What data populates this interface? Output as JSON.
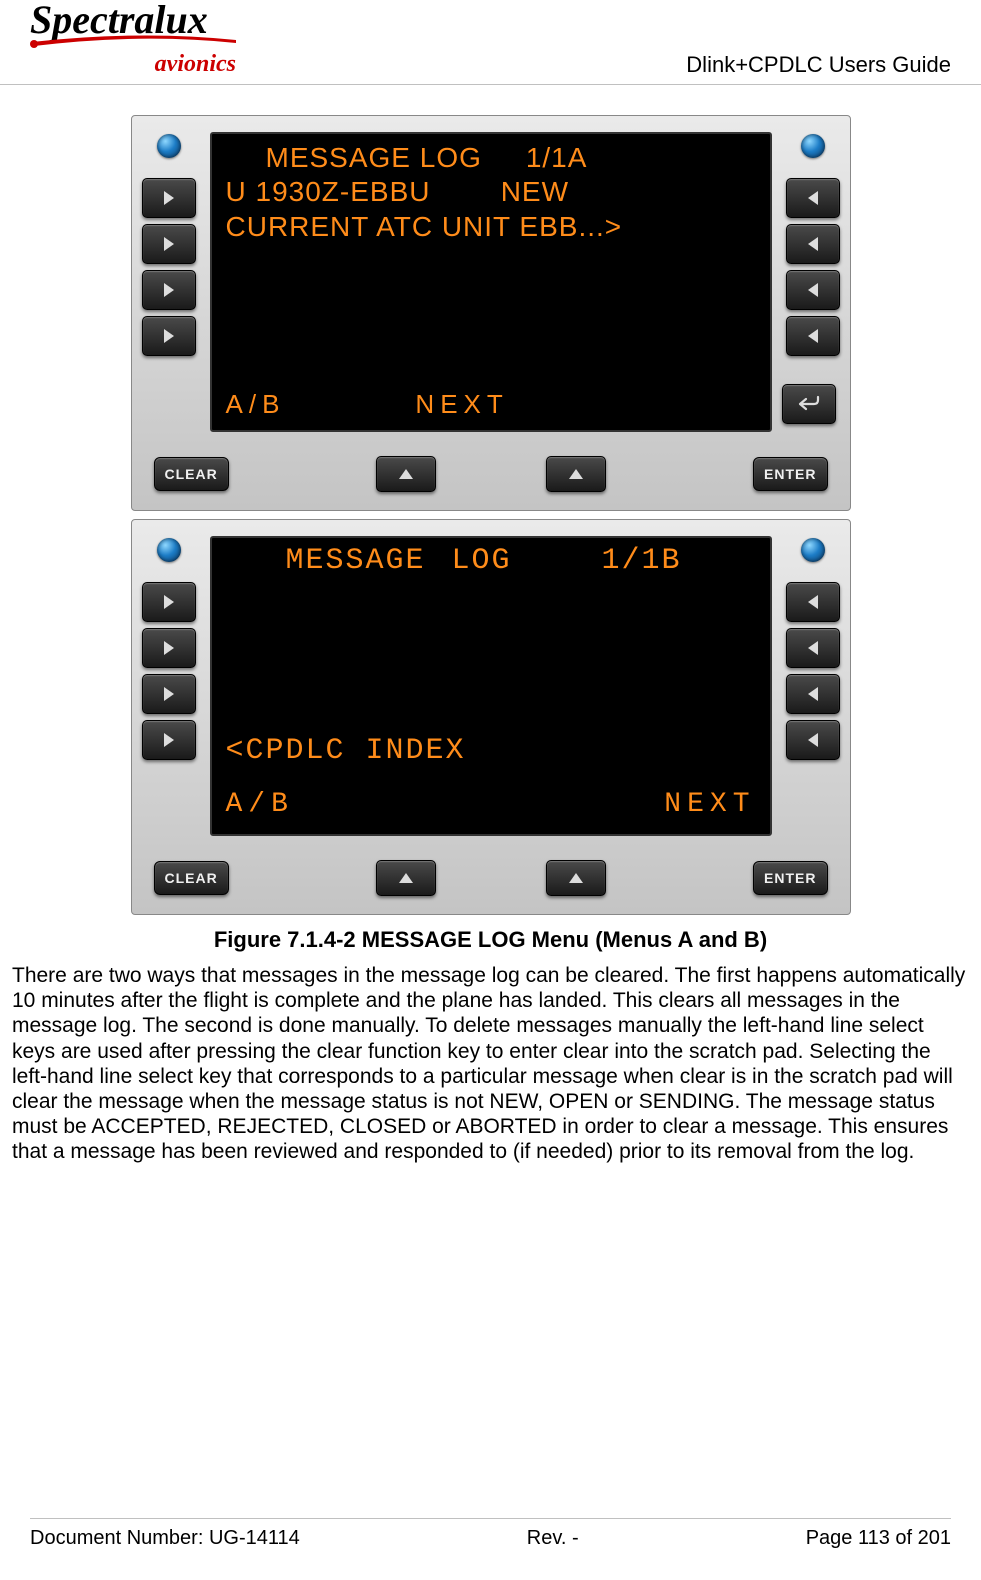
{
  "header": {
    "logo_main": "Spectralux",
    "logo_sub": "avionics",
    "doc_title": "Dlink+CPDLC Users Guide"
  },
  "device_a": {
    "title": "MESSAGE LOG",
    "page": "1/1A",
    "line1_left": "U 1930Z-EBBU",
    "line1_right": "NEW",
    "line2": "CURRENT ATC UNIT EBB...>",
    "footer_left": "A/B",
    "footer_right": "NEXT",
    "btn_clear": "CLEAR",
    "btn_enter": "ENTER"
  },
  "device_b": {
    "title": "MESSAGE LOG",
    "page": "1/1B",
    "index": "<CPDLC INDEX",
    "footer_left": "A/B",
    "footer_right": "NEXT",
    "btn_clear": "CLEAR",
    "btn_enter": "ENTER"
  },
  "caption": "Figure 7.1.4-2 MESSAGE LOG Menu (Menus A and B)",
  "paragraph": "There are two ways that messages in the message log can be cleared.  The first happens automatically 10 minutes after the flight is complete and the plane has landed.  This clears all messages in the message log.  The second is done manually.  To delete messages manually the left-hand line select keys are used after pressing the clear function key to enter clear into the scratch pad.  Selecting the left-hand line select key that corresponds to a particular message when clear is in the scratch pad will clear the message when the message status is not NEW, OPEN or SENDING.  The message status must be ACCEPTED, REJECTED, CLOSED or ABORTED in order to clear a message. This ensures that a message has been reviewed and responded to (if needed) prior to its removal from the log.",
  "footer": {
    "docnum_label": "Document Number:  ",
    "docnum": "UG-14114",
    "rev_label": "Rev. -",
    "page_label": "Page 113 of 201"
  }
}
